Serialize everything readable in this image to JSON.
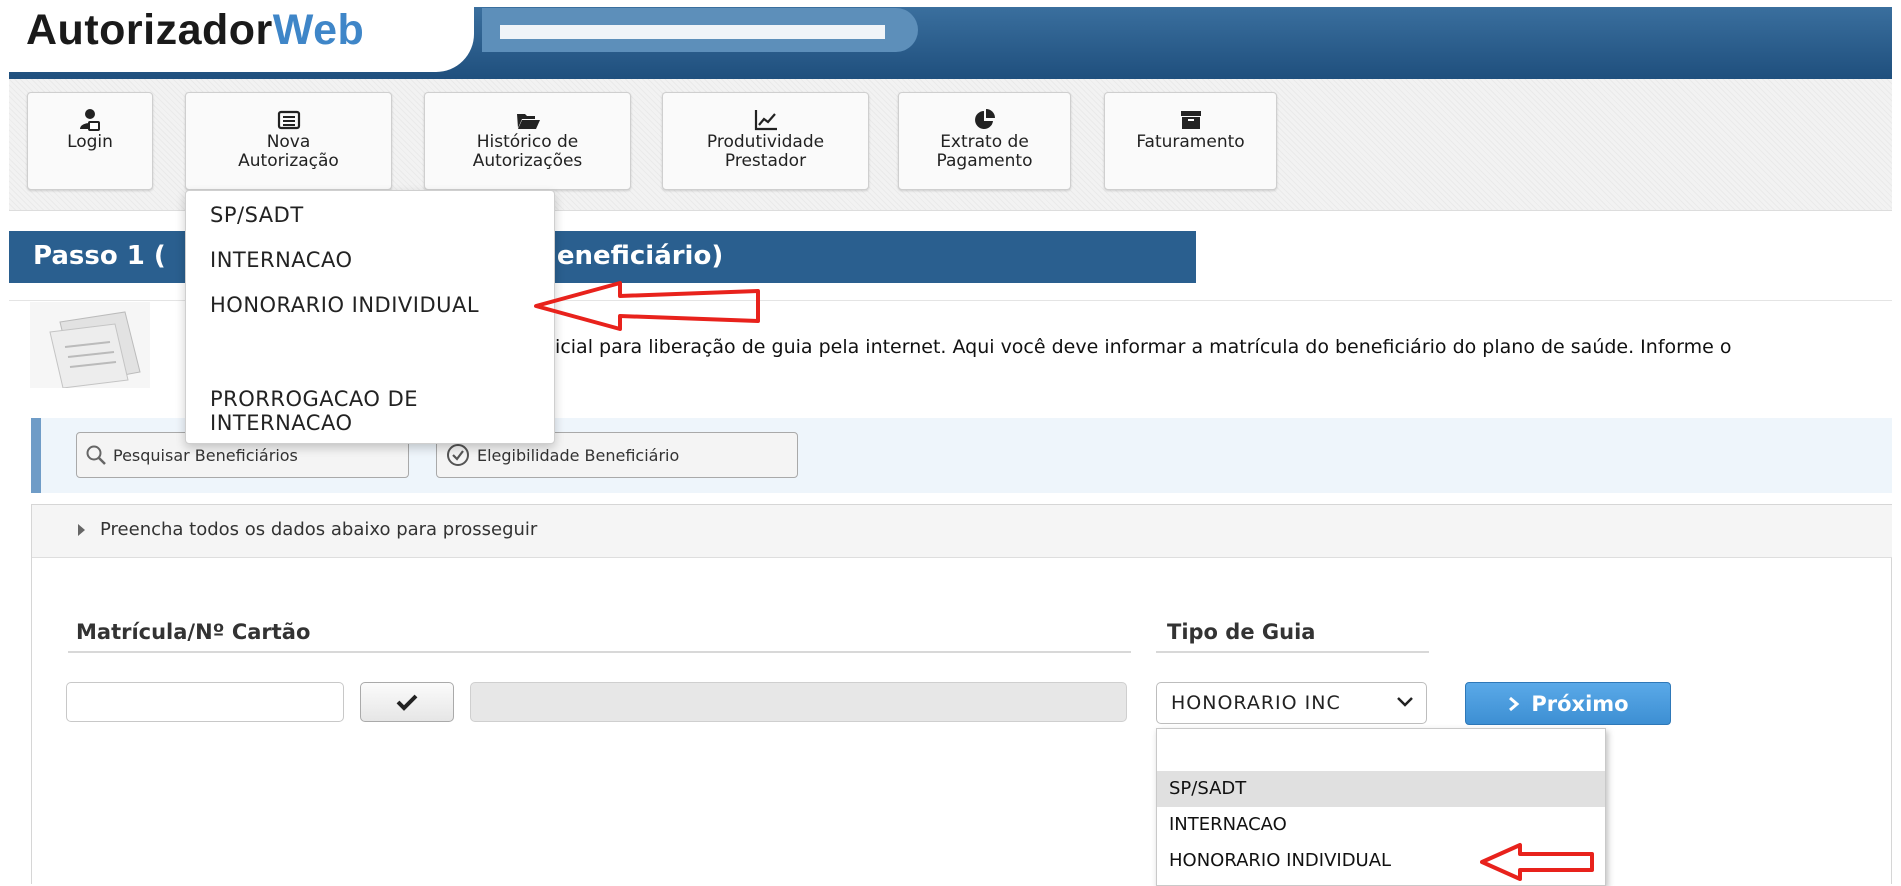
{
  "header": {
    "logo_part1": "Autorizador",
    "logo_part2": "Web"
  },
  "toolbar": {
    "buttons": [
      {
        "label": "Login",
        "icon": "user-lock-icon"
      },
      {
        "label": "Nova\nAutorização",
        "icon": "list-icon"
      },
      {
        "label": "Histórico de\nAutorizações",
        "icon": "folder-open-icon"
      },
      {
        "label": "Produtividade\nPrestador",
        "icon": "line-chart-icon"
      },
      {
        "label": "Extrato de\nPagamento",
        "icon": "pie-chart-icon"
      },
      {
        "label": "Faturamento",
        "icon": "archive-icon"
      }
    ]
  },
  "nova_menu": {
    "items": [
      "SP/SADT",
      "INTERNACAO",
      "HONORARIO INDIVIDUAL",
      "PRORROGACAO DE\nINTERNACAO"
    ]
  },
  "step": {
    "title_left": "Passo 1 (",
    "title_right": "Beneficiário)",
    "intro": "nicial para liberação de guia pela internet. Aqui você deve informar a matrícula do beneficiário do plano de saúde. Informe o"
  },
  "actions": {
    "search_label": "Pesquisar Beneficiários",
    "elig_label": "Elegibilidade Beneficiário"
  },
  "panel": {
    "hint": "Preencha todos os dados abaixo para prosseguir",
    "matricula_label": "Matrícula/Nº Cartão",
    "matricula_value": "",
    "tipo_label": "Tipo de Guia",
    "tipo_selected": "HONORARIO INC",
    "next_label": "Próximo"
  },
  "select_list": {
    "items": [
      "",
      "SP/SADT",
      "INTERNACAO",
      "HONORARIO INDIVIDUAL"
    ]
  },
  "colors": {
    "header_blue": "#1f4f7d",
    "band_blue": "#2a5f8f",
    "accent_blue": "#3d8fd3",
    "annotation_red": "#e8221c"
  }
}
